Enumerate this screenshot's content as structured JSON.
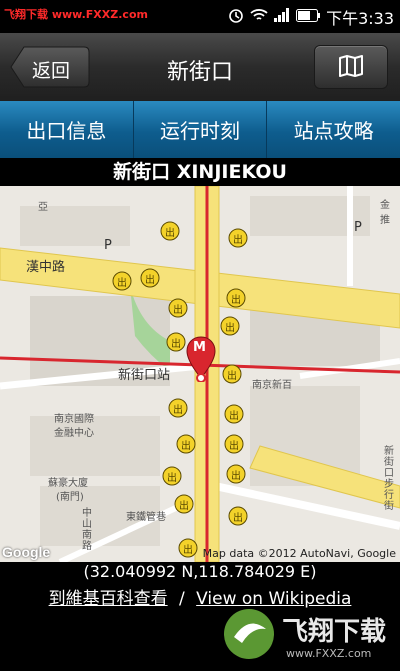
{
  "status": {
    "watermark": "飞翔下载 www.FXXZ.com",
    "time": "下午3:33"
  },
  "header": {
    "back_label": "返回",
    "title": "新街口"
  },
  "tabs": [
    {
      "label": "出口信息"
    },
    {
      "label": "运行时刻"
    },
    {
      "label": "站点攻略"
    }
  ],
  "station": {
    "title": "新街口 XINJIEKOU"
  },
  "map": {
    "labels": {
      "hanzhong_road": "漢中路",
      "station": "新街口站",
      "nanjing_xinbai": "南京新百",
      "intl_finance": "南京國際",
      "intl_finance_2": "金融中心",
      "suhu_building": "蘇豪大廈",
      "suhu_building_2": "(南門)",
      "dongshan_alley": "東鐵管巷",
      "zhongshan_south": "中山南路",
      "xinjiekou_ped": "新街口步行街",
      "qiao": "亞",
      "top_right": "金 推",
      "exit_marker": "出",
      "metro_marker": "M",
      "parking": "P"
    },
    "attribution": "Map data ©2012 AutoNavi, Google",
    "google": "Google"
  },
  "footer": {
    "coords": "(32.040992 N,118.784029 E)",
    "wiki_zh": "到維基百科查看",
    "separator": "/",
    "wiki_en": "View on Wikipedia"
  },
  "watermark_bottom": {
    "brand": "飞翔下载",
    "url": "www.FXXZ.com"
  },
  "colors": {
    "tab_blue": "#0e5d8e",
    "metro_red": "#d8262e",
    "road_yellow": "#f6e27a",
    "exit_yellow": "#f3d22a"
  }
}
